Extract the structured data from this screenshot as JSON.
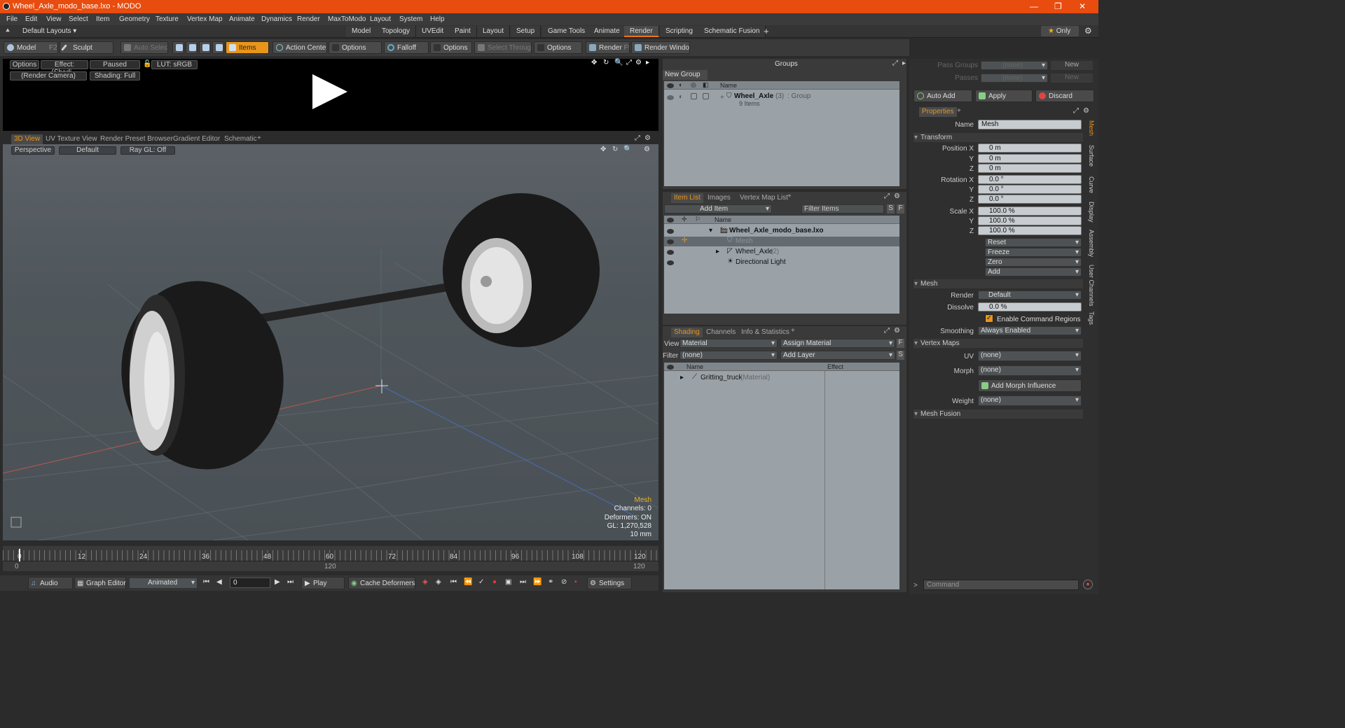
{
  "window": {
    "title": "Wheel_Axle_modo_base.lxo - MODO"
  },
  "menu": [
    "File",
    "Edit",
    "View",
    "Select",
    "Item",
    "Geometry",
    "Texture",
    "Vertex Map",
    "Animate",
    "Dynamics",
    "Render",
    "MaxToModo",
    "Layout",
    "System",
    "Help"
  ],
  "layouts": {
    "preset": "Default Layouts ▾",
    "tabs": [
      "Model",
      "Topology",
      "UVEdit",
      "Paint",
      "Layout",
      "Setup",
      "Game Tools",
      "Animate",
      "Render",
      "Scripting",
      "Schematic Fusion"
    ],
    "active": "Render",
    "only": "Only"
  },
  "toolbar": {
    "model": "Model",
    "model_key": "F2",
    "sculpt": "Sculpt",
    "auto_select": "Auto Select",
    "items": "Items",
    "action_center": "Action Center",
    "options1": "Options",
    "falloff": "Falloff",
    "options2": "Options",
    "select_through": "Select Through",
    "options3": "Options",
    "render": "Render",
    "render_key": "F9",
    "render_window": "Render Window"
  },
  "preview": {
    "options": "Options",
    "effect": "Effect: (Shadi...",
    "paused": "Paused",
    "lut": "LUT: sRGB",
    "camera": "(Render Camera)",
    "shading": "Shading: Full"
  },
  "viewport_tabs": [
    "3D View",
    "UV Texture View",
    "Render Preset Browser",
    "Gradient Editor",
    "Schematic"
  ],
  "viewport": {
    "perspective": "Perspective",
    "default": "Default",
    "raygl": "Ray GL: Off"
  },
  "stats": {
    "title": "Mesh",
    "channels": "Channels: 0",
    "deformers": "Deformers: ON",
    "gl": "GL: 1,270,528",
    "unit": "10 mm"
  },
  "timeline": {
    "ticks": [
      "0",
      "12",
      "24",
      "36",
      "48",
      "60",
      "72",
      "84",
      "96",
      "108",
      "120"
    ],
    "start": "0",
    "mid": "120",
    "end": "120"
  },
  "bottom": {
    "audio": "Audio",
    "graph_editor": "Graph Editor",
    "animated": "Animated",
    "frame": "0",
    "play": "Play",
    "cache": "Cache Deformers",
    "settings": "Settings"
  },
  "groups": {
    "title": "Groups",
    "new_group": "New Group",
    "col_name": "Name",
    "item": "Wheel_Axle",
    "item_count": "(3)",
    "item_type": ": Group",
    "item_sub": "9 Items"
  },
  "itemlist": {
    "tabs": [
      "Item List",
      "Images",
      "Vertex Map List"
    ],
    "add_item": "Add Item",
    "filter": "Filter Items",
    "col_name": "Name",
    "rows": [
      {
        "name": "Wheel_Axle_modo_base.lxo",
        "extra": ""
      },
      {
        "name": "Mesh",
        "extra": ""
      },
      {
        "name": "Wheel_Axle",
        "extra": "(2)"
      },
      {
        "name": "Directional Light",
        "extra": ""
      }
    ]
  },
  "shading": {
    "tabs": [
      "Shading",
      "Channels",
      "Info & Statistics"
    ],
    "view_label": "View",
    "view": "Material",
    "assign": "Assign Material",
    "filter_label": "Filter",
    "filter": "(none)",
    "add_layer": "Add Layer",
    "col_name": "Name",
    "col_effect": "Effect",
    "row": "Gritting_truck",
    "row_type": "(Material)"
  },
  "rightpanel": {
    "pass_groups": "Pass Groups",
    "passes": "Passes",
    "none": "(none)",
    "new": "New",
    "auto_add": "Auto Add",
    "apply": "Apply",
    "discard": "Discard",
    "properties": "Properties",
    "name_label": "Name",
    "name": "Mesh",
    "transform": "Transform",
    "pos_x_label": "Position X",
    "y": "Y",
    "z": "Z",
    "rot_x_label": "Rotation X",
    "scale_x_label": "Scale X",
    "pos": [
      "0 m",
      "0 m",
      "0 m"
    ],
    "rot": [
      "0.0 °",
      "0.0 °",
      "0.0 °"
    ],
    "scale": [
      "100.0 %",
      "100.0 %",
      "100.0 %"
    ],
    "reset": "Reset",
    "freeze": "Freeze",
    "zero": "Zero",
    "add": "Add",
    "mesh": "Mesh",
    "render_label": "Render",
    "render": "Default",
    "dissolve_label": "Dissolve",
    "dissolve": "0.0 %",
    "enable_cmd": "Enable Command Regions",
    "smoothing_label": "Smoothing",
    "smoothing": "Always Enabled",
    "vertex_maps": "Vertex Maps",
    "uv_label": "UV",
    "uv": "(none)",
    "morph_label": "Morph",
    "morph": "(none)",
    "add_morph": "Add Morph Influence",
    "weight_label": "Weight",
    "weight": "(none)",
    "mesh_fusion": "Mesh Fusion",
    "command": "Command",
    "side_tabs": [
      "Mesh",
      "Surface",
      "Curve",
      "Display",
      "Assembly",
      "User Channels",
      "Tags"
    ]
  },
  "colors": {
    "accent": "#e8951b",
    "title_bar": "#e84c0f"
  }
}
